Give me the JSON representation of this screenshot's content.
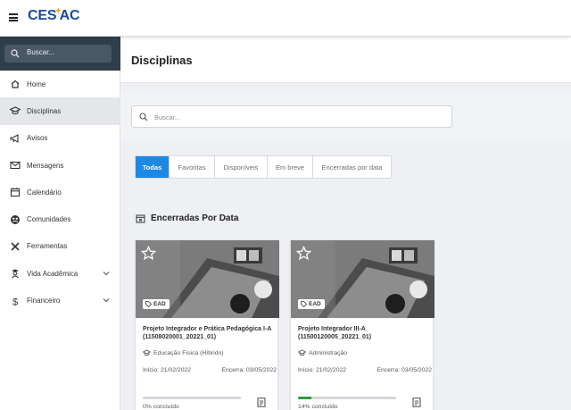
{
  "brand": {
    "logo_text_left": "CES",
    "logo_star": "✦",
    "logo_text_right": "AC",
    "accent_color": "#1a4b9b"
  },
  "sidebar": {
    "search_placeholder": "Buscar...",
    "items": [
      {
        "label": "Home",
        "icon": "home-icon",
        "active": false,
        "expandable": false
      },
      {
        "label": "Disciplinas",
        "icon": "graduation-cap-icon",
        "active": true,
        "expandable": false
      },
      {
        "label": "Avisos",
        "icon": "megaphone-icon",
        "active": false,
        "expandable": false
      },
      {
        "label": "Mensagens",
        "icon": "envelope-icon",
        "active": false,
        "expandable": false
      },
      {
        "label": "Calendário",
        "icon": "calendar-icon",
        "active": false,
        "expandable": false
      },
      {
        "label": "Comunidades",
        "icon": "community-icon",
        "active": false,
        "expandable": false
      },
      {
        "label": "Ferramentas",
        "icon": "tools-icon",
        "active": false,
        "expandable": false
      },
      {
        "label": "Vida Acadêmica",
        "icon": "student-icon",
        "active": false,
        "expandable": true
      },
      {
        "label": "Financeiro",
        "icon": "dollar-icon",
        "active": false,
        "expandable": true
      }
    ]
  },
  "main": {
    "title": "Disciplinas",
    "search_placeholder": "Buscar...",
    "tabs": [
      {
        "label": "Todas",
        "active": true
      },
      {
        "label": "Favoritas",
        "active": false
      },
      {
        "label": "Disponíveis",
        "active": false
      },
      {
        "label": "Em breve",
        "active": false
      },
      {
        "label": "Encerradas por data",
        "active": false
      }
    ],
    "section_title": "Encerradas Por Data",
    "cards": [
      {
        "badge": "EAD",
        "title": "Projeto Integrador e Prática Pedagógica I-A (11508020001_20221_01)",
        "department": "Educação Física (Híbrido)",
        "start": "Início: 21/02/2022",
        "end": "Encerra: 03/05/2022",
        "progress": 0,
        "progress_label": "0% concluído"
      },
      {
        "badge": "EAD",
        "title": "Projeto Integrador III-A (11500120005_20221_01)",
        "department": "Administração",
        "start": "Início: 21/02/2022",
        "end": "Encerra: 03/05/2022",
        "progress": 14,
        "progress_label": "14% concluído"
      }
    ]
  }
}
